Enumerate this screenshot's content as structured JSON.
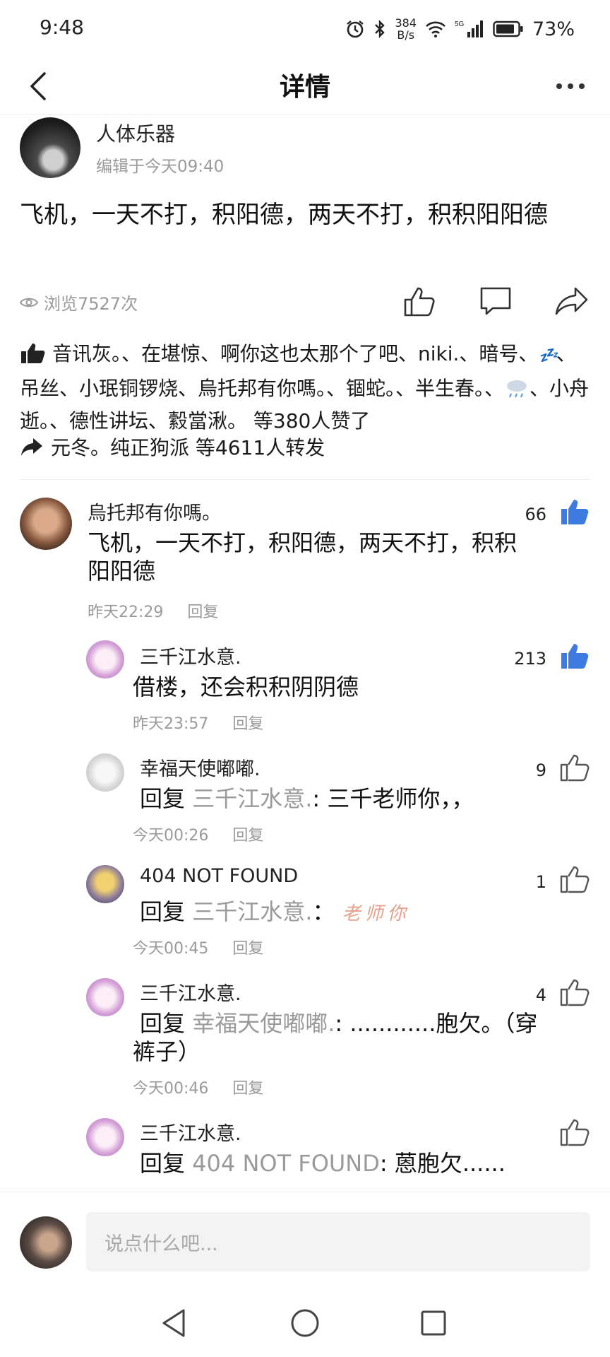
{
  "status_bar": {
    "time": "9:48",
    "net_speed_value": "384",
    "net_speed_unit": "B/s",
    "battery": "73%",
    "icons": [
      "alarm-icon",
      "bluetooth-icon",
      "wifi-icon",
      "signal-5g-icon",
      "battery-icon"
    ]
  },
  "nav": {
    "title": "详情",
    "back_icon": "back-chevron-icon",
    "more_icon": "more-dots-icon"
  },
  "post": {
    "author": "人体乐器",
    "edit_time": "编辑于今天09:40",
    "text": "飞机，一天不打，积阳德，两天不打，积积阳阳德",
    "views": "浏览7527次"
  },
  "likers": {
    "text_a": "音讯灰。、在堪惊、啊你这也太那个了吧、niki.、暗号、",
    "emoji_zzz": "💤",
    "text_b": "、吊丝、小珉铜锣烧、烏托邦有你嗎。、锢蛇。、半生春。、",
    "text_c": "、小舟逝。、德性讲坛、縠當湫。 等380人赞了"
  },
  "reposters": {
    "text": "元冬。纯正狗派 等4611人转发"
  },
  "comments": [
    {
      "name": "烏托邦有你嗎。",
      "text": "飞机，一天不打，积阳德，两天不打，积积阳阳德",
      "time": "昨天22:29",
      "reply_label": "回复",
      "likes": "66",
      "liked": true
    }
  ],
  "replies": [
    {
      "name": "三千江水意.",
      "text": "借楼，还会积积阴阴德",
      "time": "昨天23:57",
      "reply_label": "回复",
      "likes": "213",
      "liked": true
    },
    {
      "name": "幸福天使嘟嘟.",
      "prefix": "回复 ",
      "target": "三千江水意.",
      "sep": ": ",
      "text": "三千老师你，，",
      "time": "今天00:26",
      "reply_label": "回复",
      "likes": "9",
      "liked": false
    },
    {
      "name": "404 NOT FOUND",
      "prefix": "回复 ",
      "target": "三千江水意.",
      "sep": "： ",
      "handwritten": "老师你",
      "time": "今天00:45",
      "reply_label": "回复",
      "likes": "1",
      "liked": false
    },
    {
      "name": "三千江水意.",
      "prefix": "回复 ",
      "target": "幸福天使嘟嘟.",
      "sep": ": ",
      "text": "............胞欠。（穿裤子）",
      "time": "今天00:46",
      "reply_label": "回复",
      "likes": "4",
      "liked": false
    },
    {
      "name": "三千江水意.",
      "prefix": "回复 ",
      "target": "404 NOT FOUND",
      "sep": ": ",
      "text": "蒽胞欠......",
      "likes": "",
      "liked": false
    }
  ],
  "input": {
    "placeholder": "说点什么吧..."
  },
  "colors": {
    "accent_blue": "#3d7be0",
    "muted": "#9a9a9a",
    "reply_pink": "#e8a08a"
  }
}
